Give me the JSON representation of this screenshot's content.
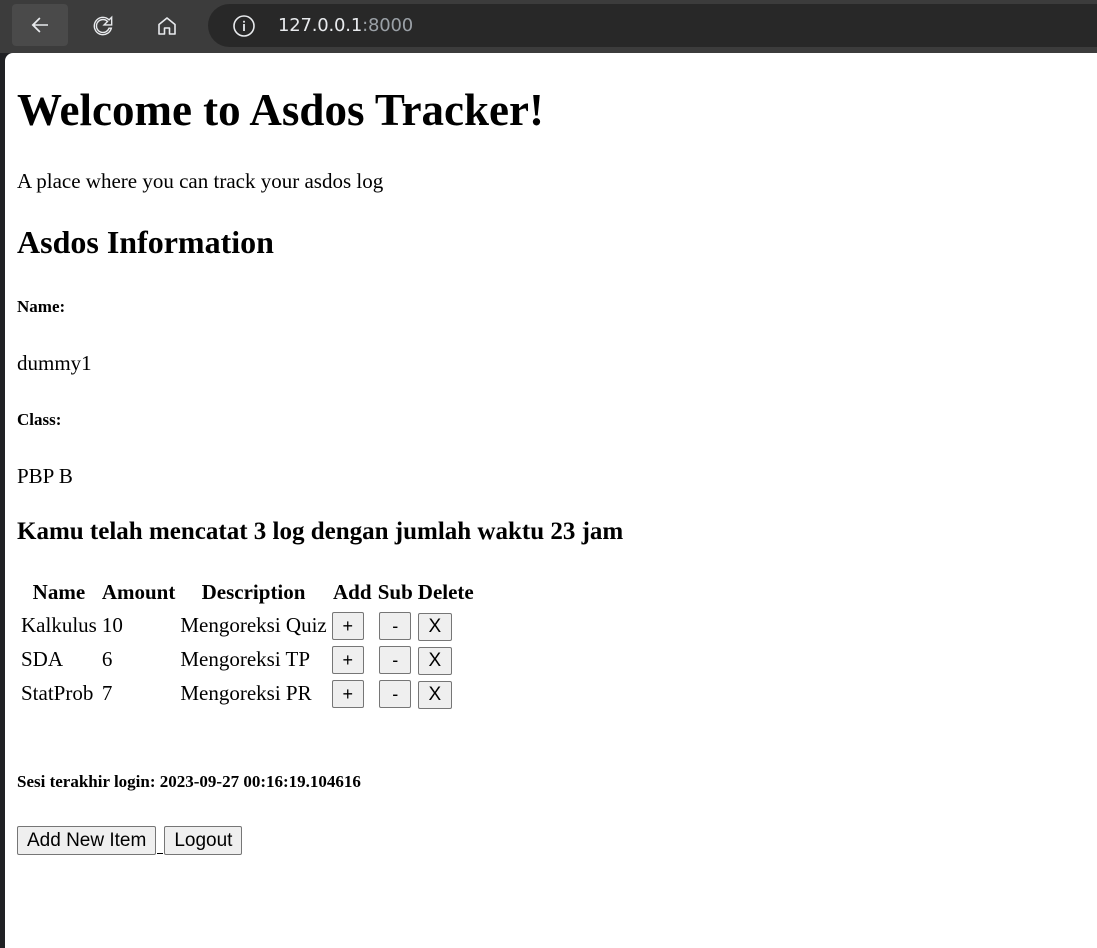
{
  "browser": {
    "url_host": "127.0.0.1",
    "url_port": ":8000",
    "back_icon": "arrow-left-icon",
    "reload_icon": "reload-icon",
    "home_icon": "home-icon",
    "info_icon": "info-icon"
  },
  "page": {
    "title": "Welcome to Asdos Tracker!",
    "subtitle": "A place where you can track your asdos log",
    "section_title": "Asdos Information",
    "name_label": "Name:",
    "name_value": "dummy1",
    "class_label": "Class:",
    "class_value": "PBP B",
    "summary": "Kamu telah mencatat 3 log dengan jumlah waktu 23 jam",
    "table": {
      "headers": [
        "Name",
        "Amount",
        "Description",
        "Add",
        "Sub",
        "Delete"
      ],
      "rows": [
        {
          "name": "Kalkulus",
          "amount": "10",
          "description": "Mengoreksi Quiz",
          "add": "+",
          "sub": "-",
          "delete": "X"
        },
        {
          "name": "SDA",
          "amount": "6",
          "description": "Mengoreksi TP",
          "add": "+",
          "sub": "-",
          "delete": "X"
        },
        {
          "name": "StatProb",
          "amount": "7",
          "description": "Mengoreksi PR",
          "add": "+",
          "sub": "-",
          "delete": "X"
        }
      ]
    },
    "last_login": "Sesi terakhir login: 2023-09-27 00:16:19.104616",
    "add_button": "Add New Item",
    "logout_button": "Logout"
  }
}
